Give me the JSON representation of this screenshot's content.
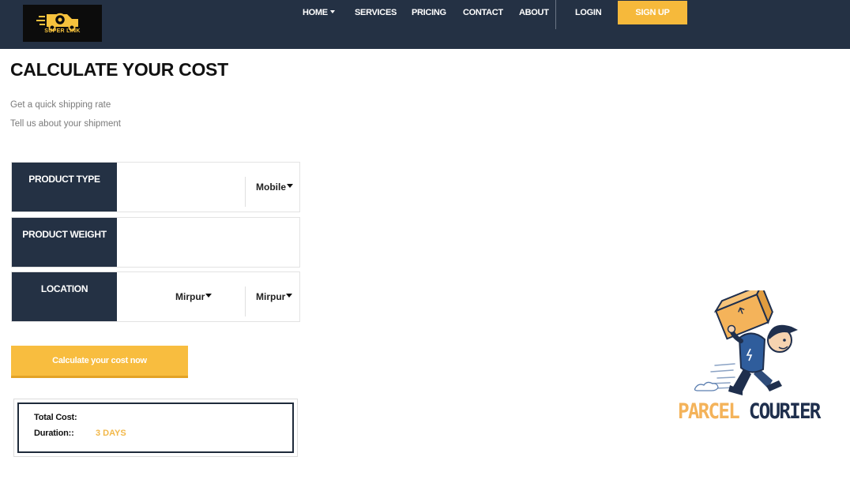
{
  "navbar": {
    "logo_text": "SUPER LINK",
    "items": [
      {
        "label": "HOME",
        "has_dropdown": true
      },
      {
        "label": "SERVICES"
      },
      {
        "label": "PRICING"
      },
      {
        "label": "CONTACT"
      },
      {
        "label": "ABOUT"
      },
      {
        "label": "LOGIN"
      }
    ],
    "signup_label": "SIGN UP"
  },
  "page": {
    "title": "CALCULATE YOUR COST",
    "subtitle_1": "Get a quick shipping rate",
    "subtitle_2": "Tell us about your shipment"
  },
  "form": {
    "product_type": {
      "label": "PRODUCT TYPE",
      "selected": "Mobile"
    },
    "product_weight": {
      "label": "PRODUCT WEIGHT",
      "value": ""
    },
    "location": {
      "label": "LOCATION",
      "from": "Mirpur",
      "to": "Mirpur"
    },
    "calculate_label": "Calculate your cost now"
  },
  "result": {
    "total_label": "Total Cost:",
    "total_value": "",
    "duration_label": "Duration::",
    "duration_value": "3 DAYS"
  },
  "illustration": {
    "text_part1": "PARCEL",
    "text_part2": "COURIER"
  },
  "colors": {
    "navy": "#243144",
    "accent": "#f6b93b",
    "duration_text": "#f2b84a"
  }
}
